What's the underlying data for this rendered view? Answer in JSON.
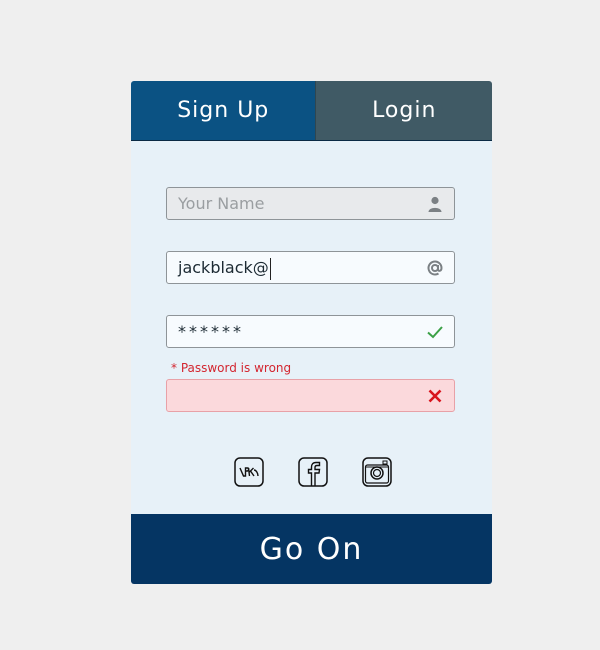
{
  "tabs": {
    "signup": "Sign Up",
    "login": "Login"
  },
  "fields": {
    "name": {
      "placeholder": "Your Name",
      "icon": "user-icon"
    },
    "email": {
      "value": "jackblack@",
      "icon": "at-icon"
    },
    "password": {
      "value": "******",
      "icon": "check-icon"
    },
    "confirm": {
      "icon": "cross-icon"
    }
  },
  "error": "* Password is wrong",
  "social": [
    "vk-icon",
    "facebook-icon",
    "instagram-icon"
  ],
  "submit": "Go On",
  "colors": {
    "accent": "#0b5283",
    "submit": "#053563",
    "error": "#d32630",
    "success": "#3ba046"
  }
}
